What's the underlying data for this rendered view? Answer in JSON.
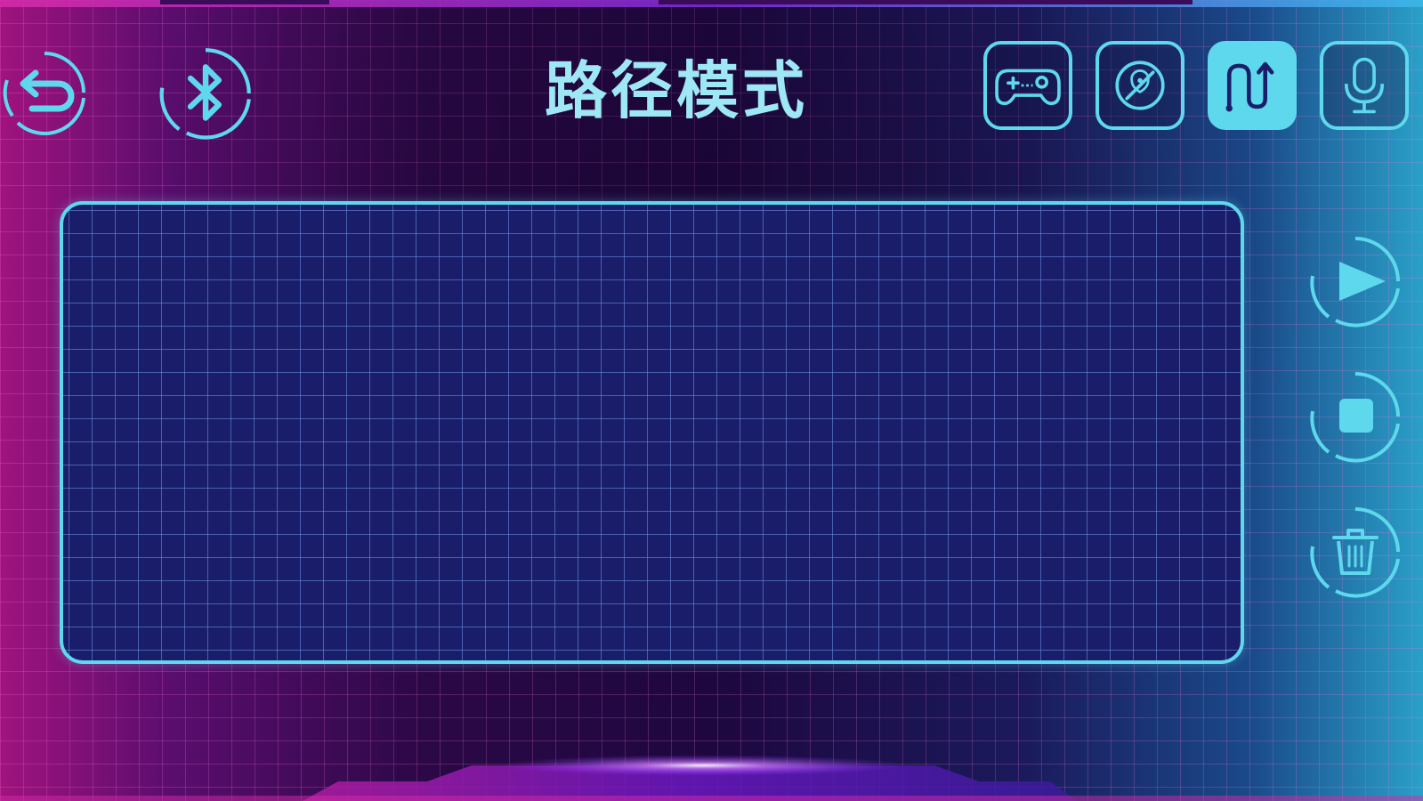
{
  "header": {
    "title": "路径模式"
  },
  "nav": {
    "back_icon": "back-arrow-icon",
    "bluetooth_icon": "bluetooth-icon"
  },
  "modes": [
    {
      "name": "gamepad",
      "icon": "gamepad-icon",
      "active": false
    },
    {
      "name": "obstacle-avoid",
      "icon": "obstacle-avoid-icon",
      "active": false
    },
    {
      "name": "path",
      "icon": "path-icon",
      "active": true
    },
    {
      "name": "voice",
      "icon": "microphone-icon",
      "active": false
    }
  ],
  "controls": {
    "play_icon": "play-icon",
    "stop_icon": "stop-icon",
    "delete_icon": "trash-icon"
  },
  "colors": {
    "accent": "#5ed8ec",
    "panel_bg": "#1a1e6a",
    "title": "#9ee7f5"
  }
}
